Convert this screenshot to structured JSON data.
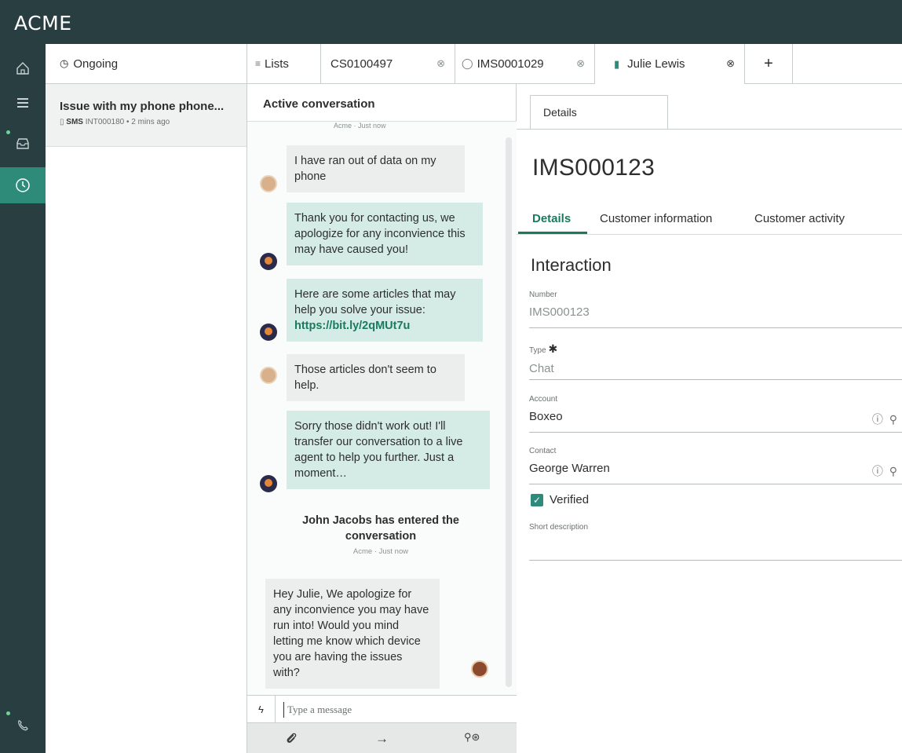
{
  "app": {
    "brand": "ACME"
  },
  "rail": {
    "items": [
      {
        "icon": "home-icon"
      },
      {
        "icon": "list-icon"
      },
      {
        "icon": "inbox-icon"
      },
      {
        "icon": "clock-icon",
        "active": true
      },
      {
        "icon": "phone-icon"
      }
    ]
  },
  "tabs": {
    "ongoing": {
      "label": "Ongoing"
    },
    "lists": {
      "label": "Lists"
    },
    "case": {
      "label": "CS0100497"
    },
    "interaction": {
      "label": "IMS0001029"
    },
    "contact": {
      "label": "Julie Lewis"
    },
    "add": {
      "label": "+"
    }
  },
  "list": {
    "items": [
      {
        "title": "Issue with my phone phone...",
        "channel": "SMS",
        "meta": "INT000180 • 2 mins ago"
      }
    ]
  },
  "chat": {
    "header": "Active conversation",
    "cut_meta": "Acme · Just now",
    "messages": [
      {
        "from": "customer",
        "text": "I have ran out of data on my phone"
      },
      {
        "from": "bot",
        "text": "Thank you for contacting us, we apologize for any inconvience this may have caused you!"
      },
      {
        "from": "bot",
        "text": "Here are some articles that may help you solve your issue:",
        "link": "https://bit.ly/2qMUt7u"
      },
      {
        "from": "customer",
        "text": "Those articles don't seem to help."
      },
      {
        "from": "bot",
        "text": "Sorry those didn't work out! I'll transfer our conversation to a live agent to help you further. Just a moment…"
      },
      {
        "from": "agent",
        "text": "Hey Julie, We apologize for any inconvience you may have run into! Would you mind letting me know which device you are having the issues with?"
      }
    ],
    "system": {
      "title": "John Jacobs has entered the conversation",
      "meta": "Acme · Just now"
    },
    "composer": {
      "placeholder": "Type a message",
      "value": ""
    }
  },
  "detail": {
    "tab": "Details",
    "record": "IMS000123",
    "subtabs": [
      "Details",
      "Customer information",
      "Customer activity"
    ],
    "section": "Interaction",
    "fields": {
      "number": {
        "label": "Number",
        "value": "IMS000123"
      },
      "type": {
        "label": "Type",
        "required_mark": "✱",
        "value": "Chat"
      },
      "account": {
        "label": "Account",
        "value": "Boxeo"
      },
      "contact": {
        "label": "Contact",
        "value": "George Warren"
      },
      "verified": {
        "label": "Verified",
        "checked": true
      },
      "short_description": {
        "label": "Short description",
        "value": ""
      }
    }
  },
  "colors": {
    "topbar": "#293e40",
    "accent": "#1a7a5e",
    "agent_bubble": "#d4ece5",
    "customer_bubble": "#eceeee"
  }
}
